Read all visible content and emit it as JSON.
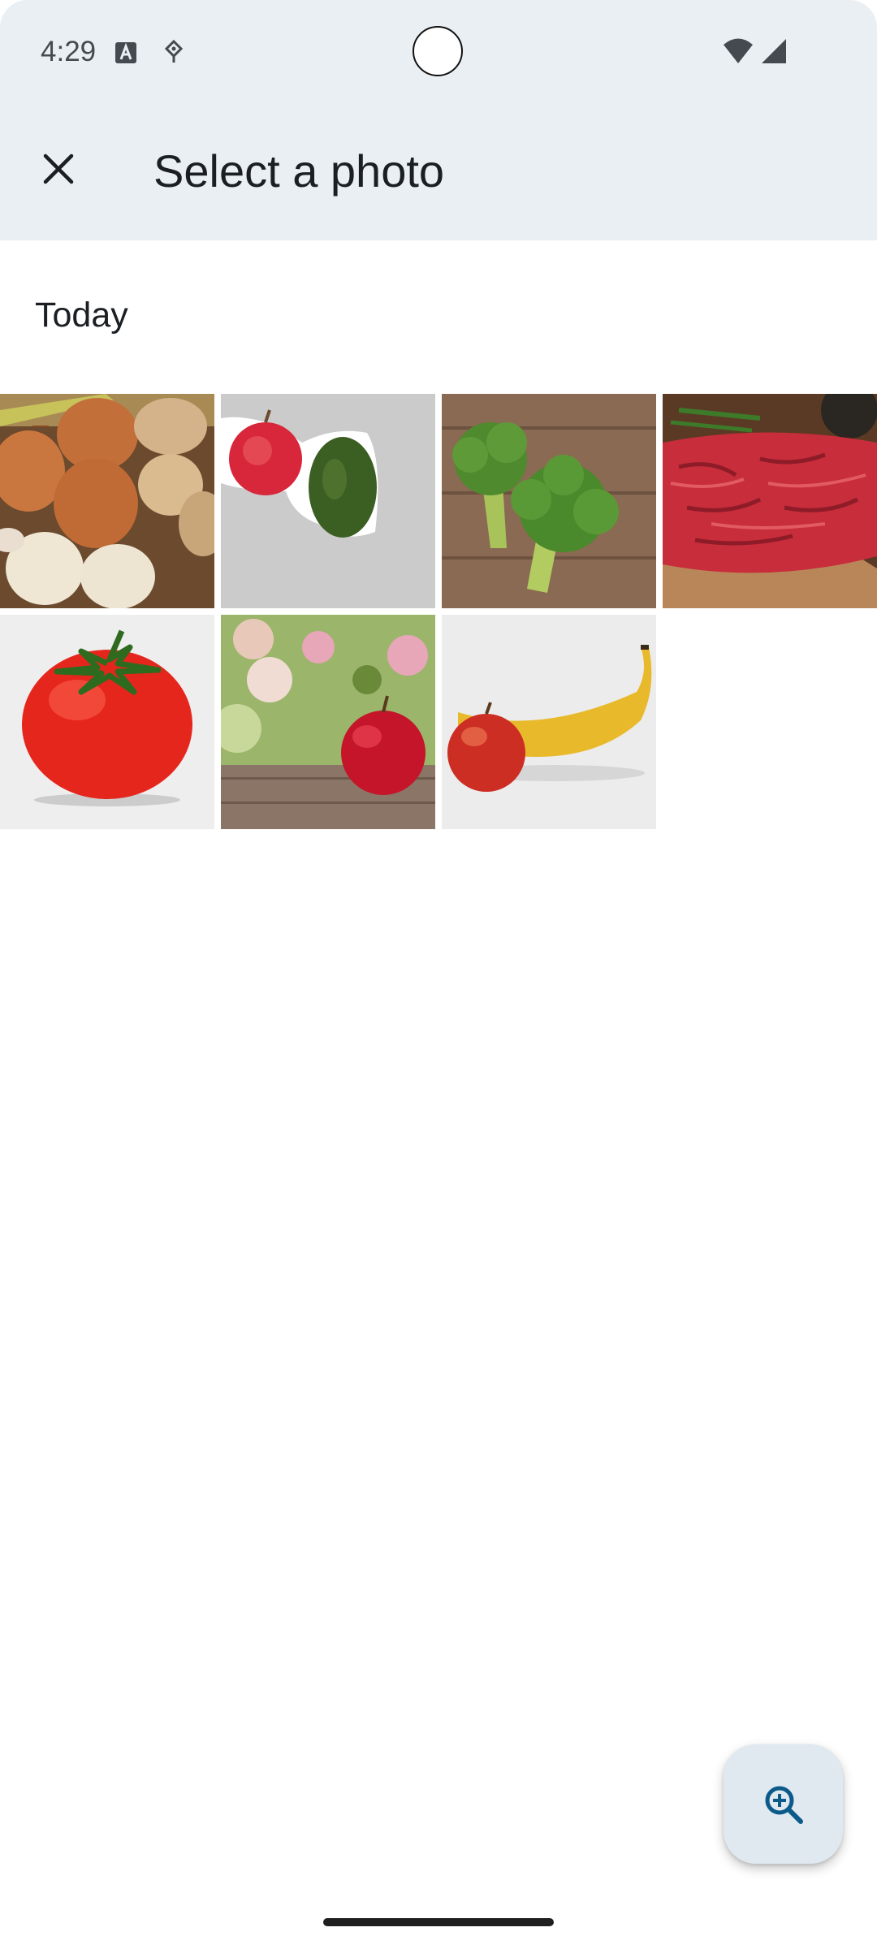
{
  "status_bar": {
    "time": "4:29",
    "icons": [
      "font-a-icon",
      "location-pin-icon",
      "wifi-icon",
      "signal-icon"
    ]
  },
  "app_bar": {
    "close_icon": "close-icon",
    "title": "Select a photo"
  },
  "section": {
    "label": "Today"
  },
  "photos": [
    {
      "subject": "onions-potatoes-garlic"
    },
    {
      "subject": "apple-and-avocado"
    },
    {
      "subject": "broccoli"
    },
    {
      "subject": "ground-beef"
    },
    {
      "subject": "tomato"
    },
    {
      "subject": "apple-with-flowers"
    },
    {
      "subject": "apple-and-banana"
    }
  ],
  "fab": {
    "icon": "zoom-in-icon"
  },
  "colors": {
    "app_bar_bg": "#e9eff3",
    "fab_bg": "#dfe9ef",
    "fab_icon": "#0b5a8a"
  }
}
